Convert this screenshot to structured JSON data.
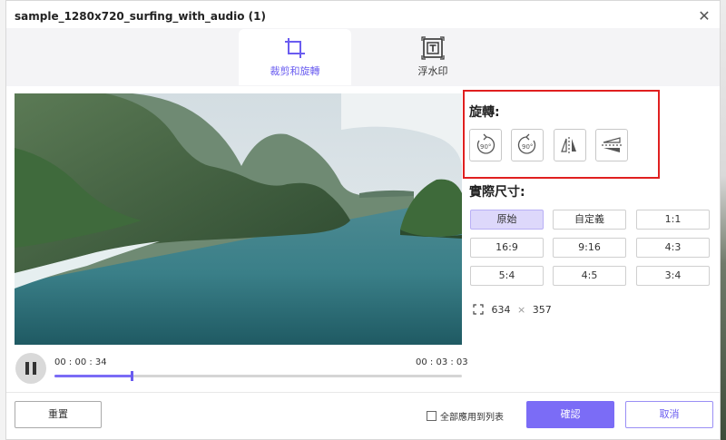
{
  "window": {
    "title": "sample_1280x720_surfing_with_audio (1)"
  },
  "tabs": [
    {
      "label": "裁剪和旋轉",
      "icon": "crop-icon",
      "active": true
    },
    {
      "label": "浮水印",
      "icon": "watermark-icon",
      "active": false
    }
  ],
  "player": {
    "current_time": "00 : 00 : 34",
    "total_time": "00 : 03 : 03",
    "progress": 0.19,
    "state": "playing"
  },
  "rotate": {
    "title": "旋轉:",
    "buttons": [
      {
        "name": "rotate-left-90-button",
        "icon": "rotate-ccw-90-icon",
        "text": "90°"
      },
      {
        "name": "rotate-right-90-button",
        "icon": "rotate-cw-90-icon",
        "text": "90°"
      },
      {
        "name": "flip-horizontal-button",
        "icon": "flip-horizontal-icon"
      },
      {
        "name": "flip-vertical-button",
        "icon": "flip-vertical-icon"
      }
    ]
  },
  "aspect": {
    "title": "實際尺寸:",
    "options": [
      "原始",
      "自定義",
      "1:1",
      "16:9",
      "9:16",
      "4:3",
      "5:4",
      "4:5",
      "3:4"
    ],
    "selected": "原始",
    "width": "634",
    "height": "357",
    "separator": "×"
  },
  "footer": {
    "reset_label": "重置",
    "apply_all_label": "全部應用到列表",
    "apply_all_checked": false,
    "confirm_label": "確認",
    "cancel_label": "取消"
  },
  "colors": {
    "accent": "#7b6cf6",
    "highlight": "#e02020",
    "selected_bg": "#ddd8fb"
  }
}
